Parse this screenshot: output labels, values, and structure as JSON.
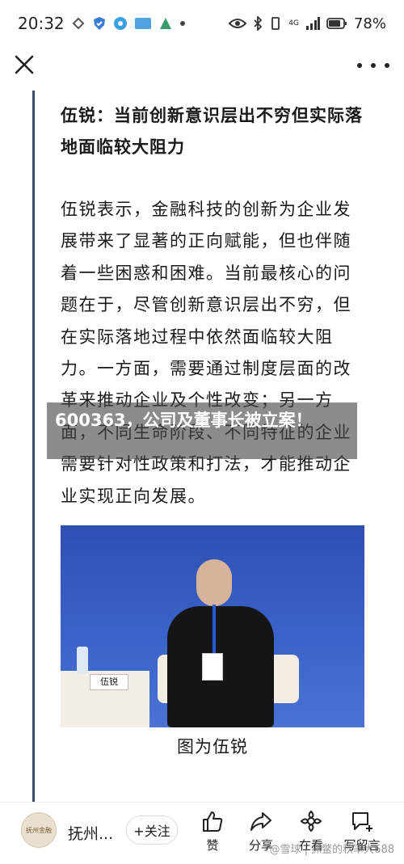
{
  "status_bar": {
    "time": "20:32",
    "network_label": "4G",
    "battery": "78%"
  },
  "article": {
    "heading": "伍锐：当前创新意识层出不穷但实际落地面临较大阻力",
    "paragraph": "伍锐表示，金融科技的创新为企业发展带来了显著的正向赋能，但也伴随着一些困惑和困难。当前最核心的问题在于，尽管创新意识层出不穷，但在实际落地过程中依然面临较大阻力。一方面，需要通过制度层面的改革来推动企业及个性改变；另一方面，不同生命阶段、不同特征的企业需要针对性政策和打法，才能推动企业实现正向发展。",
    "photo_nameplate": "伍锐",
    "caption": "图为伍锐"
  },
  "overlay": {
    "title": "600363，公司及董事长被立案！"
  },
  "bottom_bar": {
    "avatar_text": "抚州金融",
    "author": "抚州...",
    "follow_label": "+关注",
    "like_label": "赞",
    "share_label": "分享",
    "watching_label": "在看",
    "comment_label": "写留言",
    "watermark": "@雪球 | 抓鳖的秋率大688"
  },
  "colors": {
    "rule": "#3b4a6b",
    "overlay_bg": "rgba(70,70,70,0.62)",
    "photo_bg": "#3a63c9"
  }
}
